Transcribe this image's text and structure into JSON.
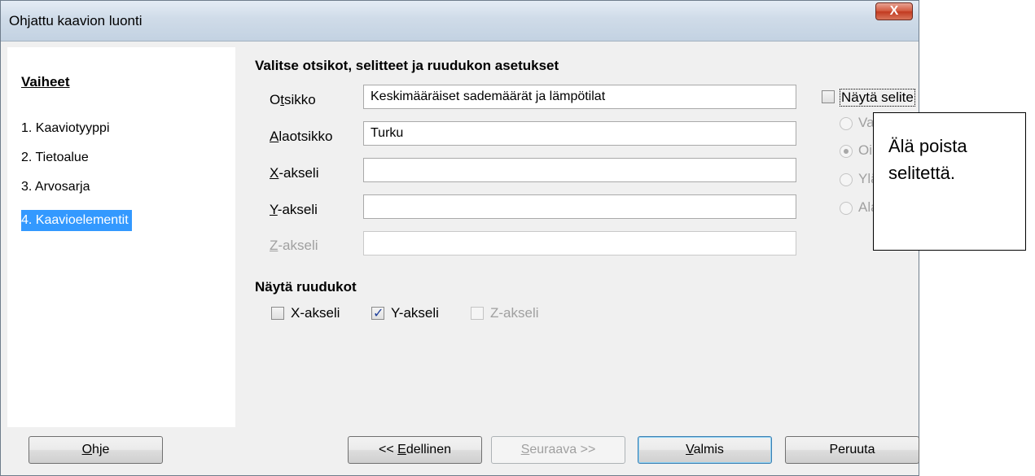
{
  "window": {
    "title": "Ohjattu kaavion luonti",
    "close_glyph": "X"
  },
  "steps": {
    "heading": "Vaiheet",
    "items": [
      {
        "label": "1. Kaaviotyyppi"
      },
      {
        "label": "2. Tietoalue"
      },
      {
        "label": "3. Arvosarja"
      },
      {
        "label": "4. Kaavioelementit",
        "active": true
      }
    ]
  },
  "titles_section": {
    "heading": "Valitse otsikot, selitteet ja ruudukon asetukset",
    "fields": {
      "title": {
        "label_pre": "O",
        "label_u": "t",
        "label_post": "sikko",
        "value": "Keskimääräiset sademäärät ja lämpötilat"
      },
      "subtitle": {
        "label_pre": "",
        "label_u": "A",
        "label_post": "laotsikko",
        "value": "Turku"
      },
      "x_axis": {
        "label_pre": "",
        "label_u": "X",
        "label_post": "-akseli",
        "value": ""
      },
      "y_axis": {
        "label_pre": "",
        "label_u": "Y",
        "label_post": "-akseli",
        "value": ""
      },
      "z_axis": {
        "label_pre": "",
        "label_u": "Z",
        "label_post": "-akseli",
        "value": "",
        "disabled": true
      }
    }
  },
  "legend": {
    "show_label": "Näytä selite",
    "checked": false,
    "positions": [
      {
        "label": "Vasen",
        "selected": false
      },
      {
        "label": "Oikea",
        "selected": true
      },
      {
        "label": "Ylä",
        "selected": false
      },
      {
        "label": "Ala",
        "selected": false
      }
    ]
  },
  "grid_section": {
    "heading": "Näytä ruudukot",
    "x_axis": {
      "label": "X-akseli",
      "checked": false
    },
    "y_axis": {
      "label": "Y-akseli",
      "checked": true
    },
    "z_axis": {
      "label": "Z-akseli",
      "checked": false,
      "disabled": true
    }
  },
  "buttons": {
    "help": {
      "u": "O",
      "rest": "hje"
    },
    "back": {
      "pre": "<< ",
      "u": "E",
      "rest": "dellinen"
    },
    "next": {
      "u": "S",
      "rest": "euraava >>",
      "disabled": true
    },
    "finish": {
      "u": "V",
      "rest": "almis"
    },
    "cancel": {
      "label": "Peruuta"
    }
  },
  "callout": {
    "line1": "Älä poista",
    "line2": "selitettä."
  }
}
